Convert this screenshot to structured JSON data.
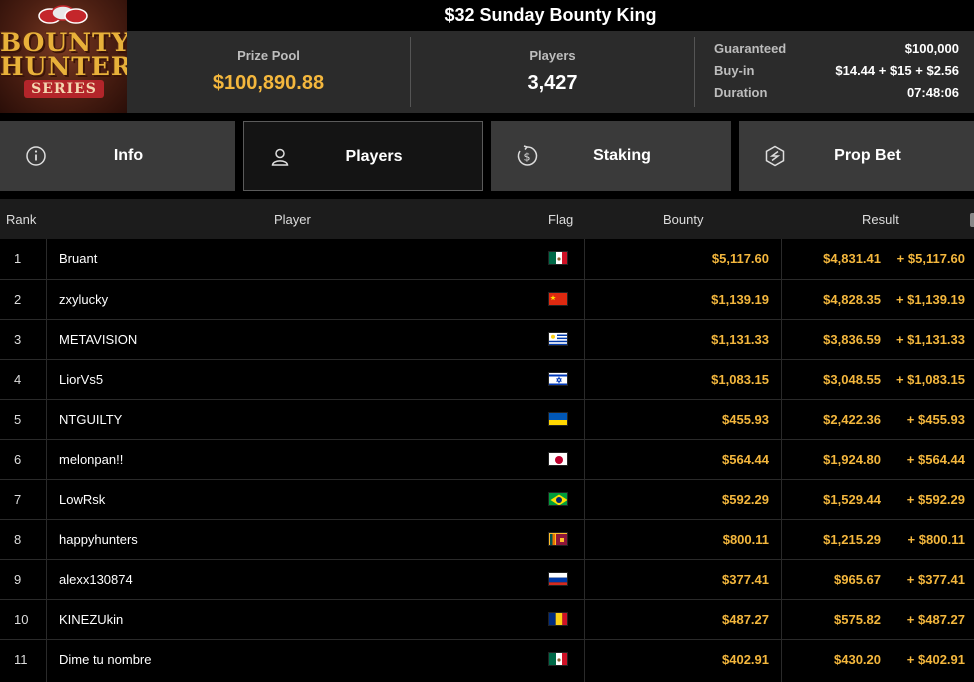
{
  "logo": {
    "line1": "BOUNTY",
    "line2": "HUNTERS",
    "line3": "SERIES"
  },
  "title": "$32 Sunday Bounty King",
  "stats": {
    "prize_pool_label": "Prize Pool",
    "prize_pool": "$100,890.88",
    "players_label": "Players",
    "players": "3,427"
  },
  "details": [
    {
      "key": "Guaranteed",
      "value": "$100,000"
    },
    {
      "key": "Buy-in",
      "value": "$14.44 + $15 + $2.56"
    },
    {
      "key": "Duration",
      "value": "07:48:06"
    }
  ],
  "tabs": [
    {
      "label": "Info",
      "icon": "info-icon"
    },
    {
      "label": "Players",
      "icon": "user-icon",
      "active": true
    },
    {
      "label": "Staking",
      "icon": "dollar-coin-icon"
    },
    {
      "label": "Prop Bet",
      "icon": "prop-bet-icon"
    }
  ],
  "columns": {
    "rank": "Rank",
    "player": "Player",
    "flag": "Flag",
    "bounty": "Bounty",
    "result": "Result"
  },
  "colors": {
    "accent": "#f4b73d",
    "header_bg": "#2b2b2b",
    "tab_bg": "#3a3a3a"
  },
  "rows": [
    {
      "rank": "1",
      "player": "Bruant",
      "flag": "mexico",
      "bounty": "$5,117.60",
      "result": "$4,831.41",
      "plus": "+ $5,117.60"
    },
    {
      "rank": "2",
      "player": "zxylucky",
      "flag": "china",
      "bounty": "$1,139.19",
      "result": "$4,828.35",
      "plus": "+ $1,139.19"
    },
    {
      "rank": "3",
      "player": "METAVISION",
      "flag": "uruguay",
      "bounty": "$1,131.33",
      "result": "$3,836.59",
      "plus": "+ $1,131.33"
    },
    {
      "rank": "4",
      "player": "LiorVs5",
      "flag": "israel",
      "bounty": "$1,083.15",
      "result": "$3,048.55",
      "plus": "+ $1,083.15"
    },
    {
      "rank": "5",
      "player": "NTGUILTY",
      "flag": "ukraine",
      "bounty": "$455.93",
      "result": "$2,422.36",
      "plus": "+ $455.93"
    },
    {
      "rank": "6",
      "player": "melonpan!!",
      "flag": "japan",
      "bounty": "$564.44",
      "result": "$1,924.80",
      "plus": "+ $564.44"
    },
    {
      "rank": "7",
      "player": "LowRsk",
      "flag": "brazil",
      "bounty": "$592.29",
      "result": "$1,529.44",
      "plus": "+ $592.29"
    },
    {
      "rank": "8",
      "player": "happyhunters",
      "flag": "sri-lanka",
      "bounty": "$800.11",
      "result": "$1,215.29",
      "plus": "+ $800.11"
    },
    {
      "rank": "9",
      "player": "alexx130874",
      "flag": "russia",
      "bounty": "$377.41",
      "result": "$965.67",
      "plus": "+ $377.41"
    },
    {
      "rank": "10",
      "player": "KINEZUkin",
      "flag": "romania",
      "bounty": "$487.27",
      "result": "$575.82",
      "plus": "+ $487.27"
    },
    {
      "rank": "11",
      "player": "Dime tu nombre",
      "flag": "mexico",
      "bounty": "$402.91",
      "result": "$430.20",
      "plus": "+ $402.91"
    }
  ]
}
